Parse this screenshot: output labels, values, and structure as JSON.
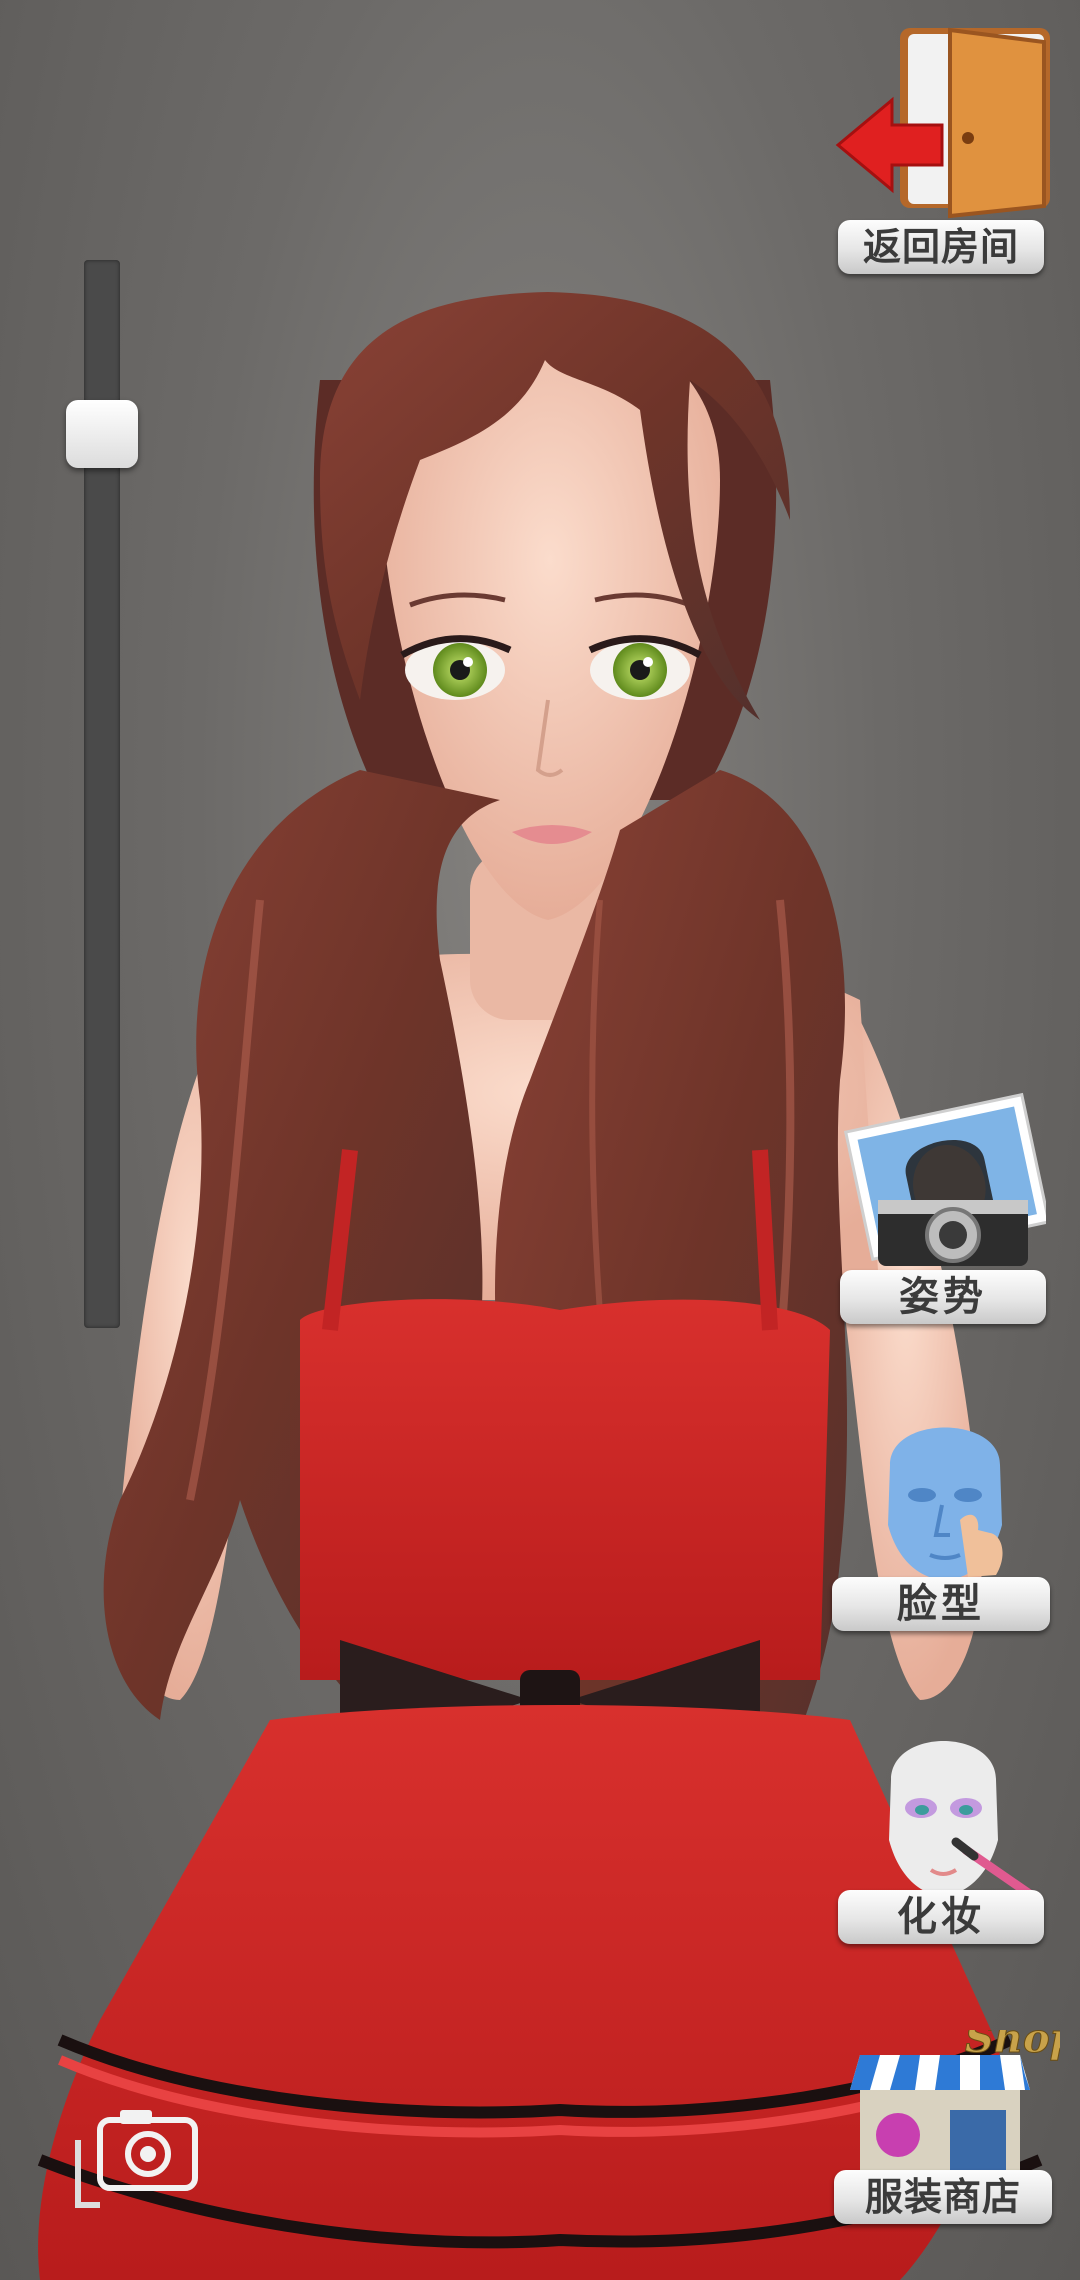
{
  "buttons": {
    "back_room": "返回房间",
    "pose": "姿势",
    "face_shape": "脸型",
    "makeup": "化妆",
    "clothing_shop": "服装商店",
    "shop_sign": "Shop"
  },
  "zoom_slider": {
    "level": 0.86
  },
  "colors": {
    "background": "#6c6a68",
    "dress": "#d42a2a",
    "hair": "#7a3a30",
    "eyes": "#8bb83a",
    "skin": "#f3c7b4",
    "door_orange": "#d98a3a",
    "arrow_red": "#e02020"
  },
  "icons": {
    "back_room": "door-exit-icon",
    "pose": "photo-camera-icon",
    "face_shape": "face-model-icon",
    "makeup": "makeup-brush-icon",
    "clothing_shop": "shop-storefront-icon",
    "screenshot": "camera-icon"
  }
}
